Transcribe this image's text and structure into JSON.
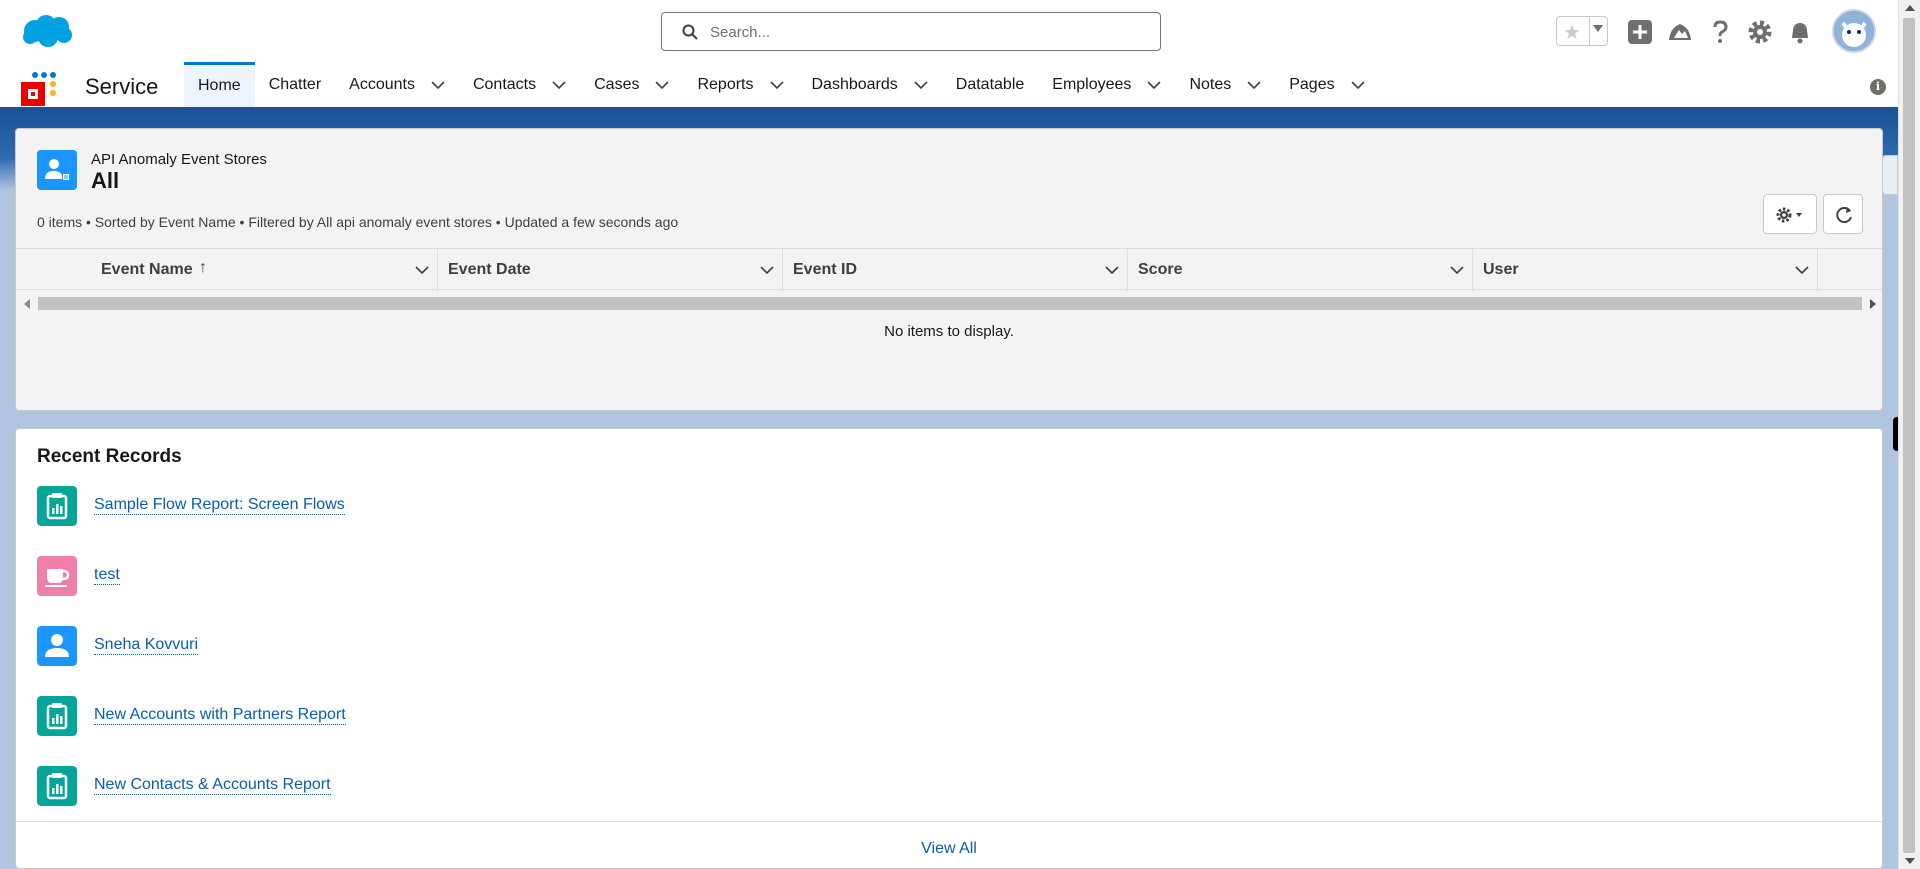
{
  "header": {
    "search_placeholder": "Search..."
  },
  "nav": {
    "app_name": "Service",
    "tabs": [
      {
        "label": "Home",
        "dropdown": false,
        "active": true
      },
      {
        "label": "Chatter",
        "dropdown": false
      },
      {
        "label": "Accounts",
        "dropdown": true
      },
      {
        "label": "Contacts",
        "dropdown": true
      },
      {
        "label": "Cases",
        "dropdown": true
      },
      {
        "label": "Reports",
        "dropdown": true
      },
      {
        "label": "Dashboards",
        "dropdown": true
      },
      {
        "label": "Datatable",
        "dropdown": false
      },
      {
        "label": "Employees",
        "dropdown": true
      },
      {
        "label": "Notes",
        "dropdown": true
      },
      {
        "label": "Pages",
        "dropdown": true
      }
    ]
  },
  "list_view": {
    "object_label": "API Anomaly Event Stores",
    "title": "All",
    "meta": "0 items • Sorted by Event Name • Filtered by All api anomaly event stores • Updated a few seconds ago",
    "columns": [
      "Event Name",
      "Event Date",
      "Event ID",
      "Score",
      "User"
    ],
    "sort_indicator": "↑",
    "empty_message": "No items to display."
  },
  "recent": {
    "title": "Recent Records",
    "items": [
      {
        "label": "Sample Flow Report: Screen Flows",
        "icon": "report-icon",
        "color": "#06a59a"
      },
      {
        "label": "test",
        "icon": "cup-icon",
        "color": "#f07fac"
      },
      {
        "label": "Sneha Kovvuri",
        "icon": "user-icon",
        "color": "#1b96ff"
      },
      {
        "label": "New Accounts with Partners Report",
        "icon": "report-icon",
        "color": "#06a59a"
      },
      {
        "label": "New Contacts & Accounts Report",
        "icon": "report-icon",
        "color": "#06a59a"
      }
    ],
    "view_all": "View All"
  }
}
